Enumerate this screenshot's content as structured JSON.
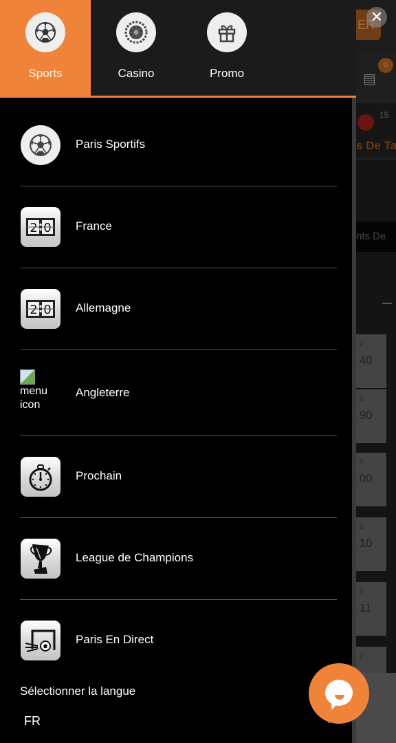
{
  "background_page": {
    "register_button_partial": "ER",
    "betslip_badge": "0",
    "sport_count": "15",
    "sport_label_partial": "s De Tab",
    "tab_partial": "nts De",
    "odds": [
      {
        "label": "2",
        "value": ".40"
      },
      {
        "label": "2",
        "value": ".90"
      },
      {
        "label": "2",
        "value": ".00"
      },
      {
        "label": "2",
        "value": ".10"
      },
      {
        "label": "2",
        "value": ".11"
      },
      {
        "label": "2",
        "value": ""
      }
    ]
  },
  "top_tabs": [
    {
      "label": "Sports",
      "icon": "soccer-ball-icon",
      "active": true
    },
    {
      "label": "Casino",
      "icon": "roulette-icon",
      "active": false
    },
    {
      "label": "Promo",
      "icon": "gift-icon",
      "active": false
    }
  ],
  "menu": {
    "items": [
      {
        "label": "Paris Sportifs",
        "icon": "soccer-ball-icon"
      },
      {
        "label": "France",
        "icon": "scoreboard-icon",
        "score": "2:0"
      },
      {
        "label": "Allemagne",
        "icon": "scoreboard-icon",
        "score": "2:0"
      },
      {
        "label": "Angleterre",
        "icon": "broken-image-icon",
        "alt": "menu icon"
      },
      {
        "label": "Prochain",
        "icon": "stopwatch-icon"
      },
      {
        "label": "League de Champions",
        "icon": "trophy-icon"
      },
      {
        "label": "Paris En Direct",
        "icon": "goal-icon"
      }
    ]
  },
  "language": {
    "label": "Sélectionner la langue",
    "selected": "FR"
  },
  "close_label": "✕",
  "colors": {
    "accent": "#f0833a",
    "drawer_bg": "#000000",
    "tabs_bg": "#1b1b1b"
  }
}
